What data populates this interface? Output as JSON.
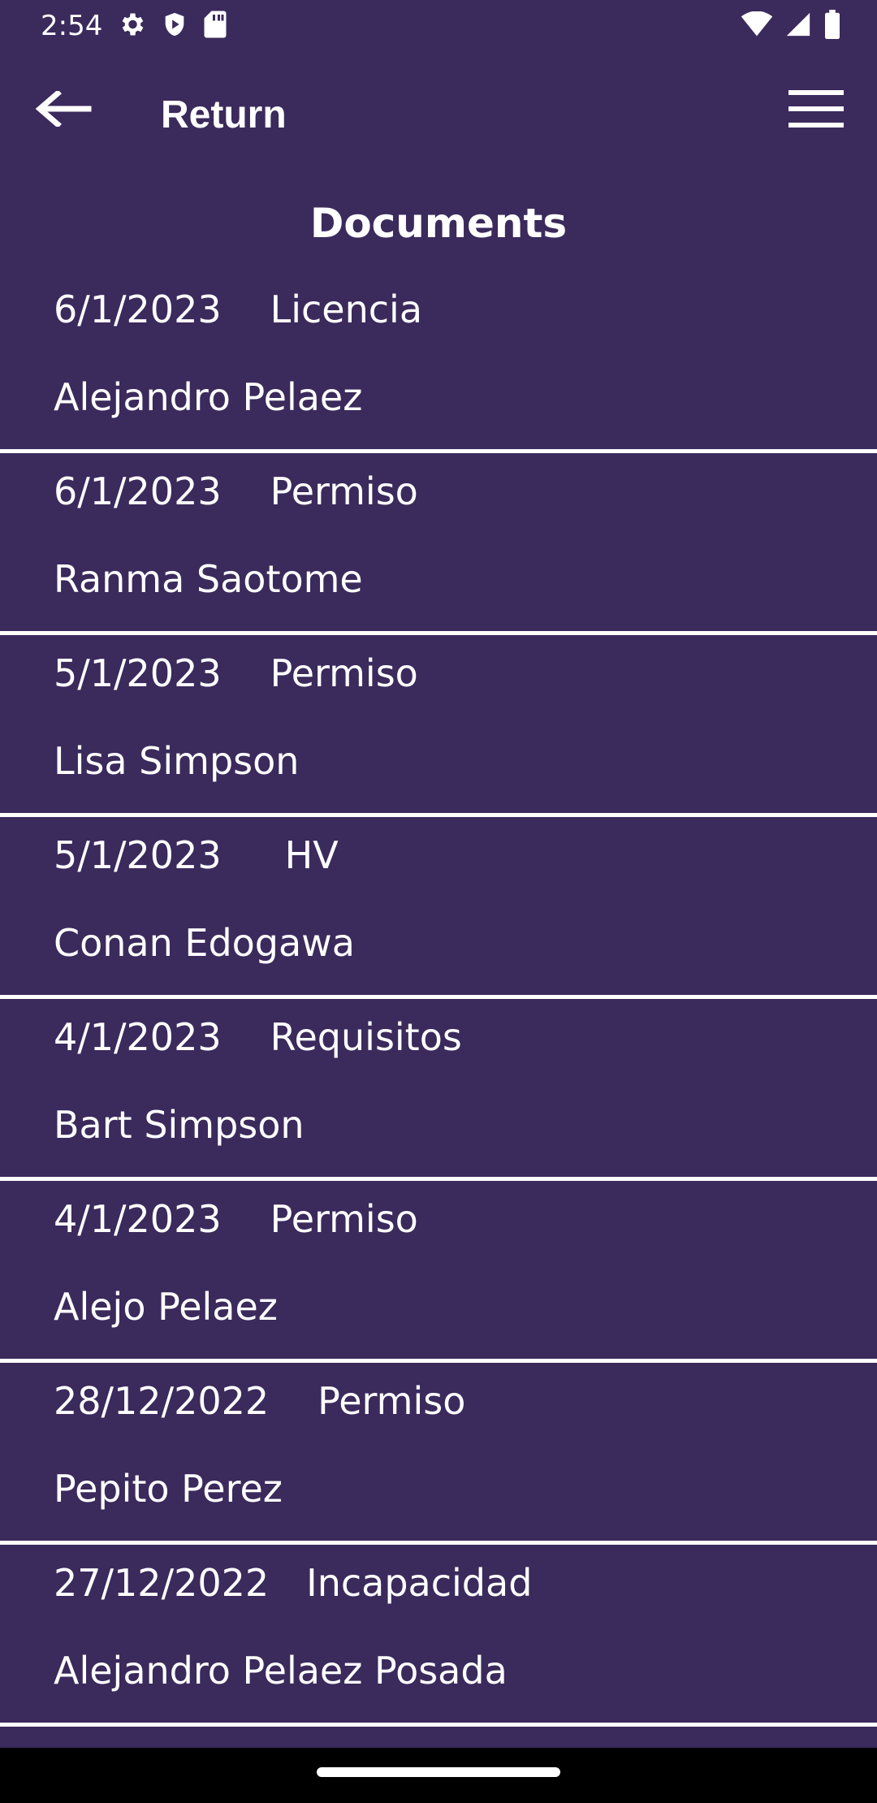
{
  "status_bar": {
    "time": "2:54",
    "left_icons": [
      "gear-icon",
      "shield-play-icon",
      "sd-card-icon"
    ],
    "right_icons": [
      "wifi-icon",
      "cellular-signal-icon",
      "battery-icon"
    ]
  },
  "app_bar": {
    "title": "Return",
    "back_icon": "arrow-left-icon",
    "menu_icon": "hamburger-menu-icon"
  },
  "section_title": "Documents",
  "documents": [
    {
      "date": "6/1/2023",
      "type": "Licencia",
      "name": "Alejandro Pelaez"
    },
    {
      "date": "6/1/2023",
      "type": "Permiso",
      "name": "Ranma Saotome"
    },
    {
      "date": "5/1/2023",
      "type": "Permiso",
      "name": "Lisa Simpson"
    },
    {
      "date": "5/1/2023",
      "type": "HV",
      "name": "Conan Edogawa"
    },
    {
      "date": "4/1/2023",
      "type": "Requisitos",
      "name": "Bart Simpson"
    },
    {
      "date": "4/1/2023",
      "type": "Permiso",
      "name": "Alejo Pelaez"
    },
    {
      "date": "28/12/2022",
      "type": "Permiso",
      "name": "Pepito Perez"
    },
    {
      "date": "27/12/2022",
      "type": "Incapacidad",
      "name": "Alejandro Pelaez Posada"
    }
  ],
  "colors": {
    "background": "#3b2a5c",
    "text": "#ffffff",
    "divider": "#ffffff",
    "nav_bar": "#000000"
  }
}
